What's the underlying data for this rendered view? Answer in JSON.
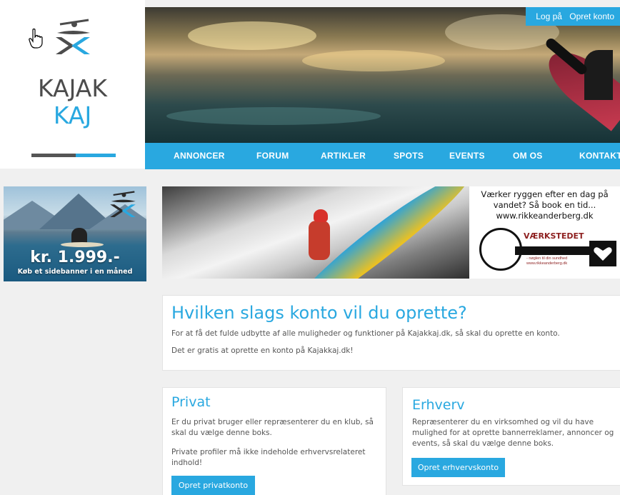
{
  "logo": {
    "line1": "KAJAK",
    "line2": "KAJ",
    "icon": "kayaker-logo-icon"
  },
  "auth": {
    "login": "Log på",
    "register": "Opret konto"
  },
  "nav": {
    "items": [
      "ANNONCER",
      "FORUM",
      "ARTIKLER",
      "SPOTS",
      "EVENTS",
      "OM OS",
      "KONTAKT"
    ]
  },
  "side_banner": {
    "price": "kr. 1.999.-",
    "subtitle": "Køb et sidebanner i en måned"
  },
  "ad_right": {
    "line1": "Værker ryggen efter en dag på",
    "line2": "vandet? Så book en tid...",
    "line3": "www.rikkeanderberg.dk",
    "brand": "VÆRKSTEDET",
    "small1": "- nøglen til din sundhed",
    "small2": "www.rikkeanderberg.dk"
  },
  "intro": {
    "title": "Hvilken slags konto vil du oprette?",
    "p1": "For at få det fulde udbytte af alle muligheder og funktioner på Kajakkaj.dk, så skal du oprette en konto.",
    "p2": "Det er gratis at oprette en konto på Kajakkaj.dk!"
  },
  "private": {
    "title": "Privat",
    "p1a": "Er du privat bruger eller repræsenterer du en klub, så",
    "p1b": "skal du vælge denne boks.",
    "p2a": "Private profiler må ikke indeholde erhvervsrelateret",
    "p2b": "indhold!",
    "button": "Opret privatkonto"
  },
  "business": {
    "title": "Erhverv",
    "p1a": "Repræsenterer du en virksomhed og vil du have",
    "p1b": "mulighed for at oprette bannerreklamer, annoncer og",
    "p1c": "events, så skal du vælge denne boks.",
    "button": "Opret erhvervskonto"
  },
  "colors": {
    "accent": "#29a8e0",
    "logo_dark": "#4c4c4c",
    "background": "#f0f0f0"
  }
}
